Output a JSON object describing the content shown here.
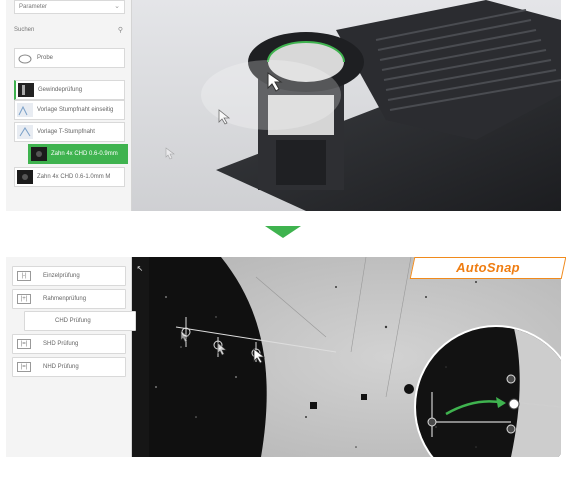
{
  "top": {
    "dropdown_value": "Parameter",
    "search_label": "Suchen",
    "items": [
      {
        "label": "Probe"
      },
      {
        "label": "Gewindeprüfung"
      },
      {
        "label": "Vorlage Stumpfnaht einseitig"
      },
      {
        "label": "Vorlage T-Stumpfnaht"
      },
      {
        "label": "Zahn 4x CHD 0.6-0.9mm"
      },
      {
        "label": "Zahn 4x CHD 0.6-1.0mm M"
      }
    ]
  },
  "bottom": {
    "items": [
      {
        "label": "Einzelprüfung",
        "icon": "|-|"
      },
      {
        "label": "Rahmenprüfung",
        "icon": "|+|"
      },
      {
        "label": "CHD Prüfung",
        "icon": "==="
      },
      {
        "label": "SHD Prüfung",
        "icon": "|=|"
      },
      {
        "label": "NHD Prüfung",
        "icon": "|=|"
      }
    ]
  },
  "badge": {
    "label": "AutoSnap"
  },
  "colors": {
    "accent": "#3fb34f",
    "badge": "#ef7d12"
  }
}
